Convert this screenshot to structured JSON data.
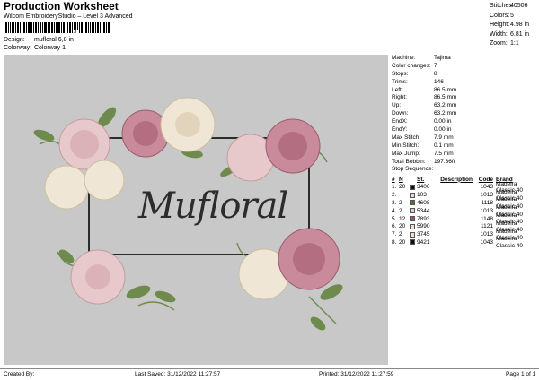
{
  "header": {
    "title": "Production Worksheet",
    "subtitle": "Wilcom EmbroideryStudio – Level 3 Advanced",
    "barcode_number": "3",
    "design_label": "Design:",
    "design_value": "mufloral 6,8 in",
    "colorway_label": "Colorway:",
    "colorway_value": "Colorway 1"
  },
  "top_stats": [
    {
      "label": "Stitches:",
      "value": "40506"
    },
    {
      "label": "Colors:",
      "value": "5"
    },
    {
      "label": "Height:",
      "value": "4.98 in"
    },
    {
      "label": "Width:",
      "value": "6.81 in"
    },
    {
      "label": "Zoom:",
      "value": "1:1"
    }
  ],
  "preview": {
    "text": "Mufloral",
    "background": "#c8c8c8"
  },
  "details": [
    {
      "label": "Machine:",
      "value": "Tajima"
    },
    {
      "label": "Color changes:",
      "value": "7"
    },
    {
      "label": "Stops:",
      "value": "8"
    },
    {
      "label": "Trims:",
      "value": "146"
    },
    {
      "label": "Left:",
      "value": "86.5 mm"
    },
    {
      "label": "Right:",
      "value": "86.5 mm"
    },
    {
      "label": "Up:",
      "value": "63.2 mm"
    },
    {
      "label": "Down:",
      "value": "63.2 mm"
    },
    {
      "label": "EndX:",
      "value": "0.00 in"
    },
    {
      "label": "EndY:",
      "value": "0.00 in"
    },
    {
      "label": "Max Stitch:",
      "value": "7.9 mm"
    },
    {
      "label": "Min Stitch:",
      "value": "0.1 mm"
    },
    {
      "label": "Max Jump:",
      "value": "7.5 mm"
    },
    {
      "label": "Total Bobbin:",
      "value": "197.36ft"
    }
  ],
  "sequence": {
    "title": "Stop Sequence:",
    "headers": {
      "n": "#",
      "n2": "N",
      "st": "St.",
      "desc": "Description",
      "code": "Code",
      "brand": "Brand"
    },
    "rows": [
      {
        "n": "1.",
        "needle": "20",
        "color": "#111111",
        "stitches": "3400",
        "code": "1043",
        "brand": "Madeira Classic 40"
      },
      {
        "n": "2.",
        "needle": "",
        "color": "#ead7d2",
        "stitches": "103",
        "code": "1013",
        "brand": "Madeira Classic 40"
      },
      {
        "n": "3.",
        "needle": "2",
        "color": "#5c6b3a",
        "stitches": "4608",
        "code": "1118",
        "brand": "Madeira Classic 40"
      },
      {
        "n": "4.",
        "needle": "2",
        "color": "#e3cfc4",
        "stitches": "5344",
        "code": "1013",
        "brand": "Madeira Classic 40"
      },
      {
        "n": "5.",
        "needle": "12",
        "color": "#b04a6a",
        "stitches": "7893",
        "code": "1148",
        "brand": "Madeira Classic 40"
      },
      {
        "n": "6.",
        "needle": "20",
        "color": "#f0d8e0",
        "stitches": "5990",
        "code": "1121",
        "brand": "Madeira Classic 40"
      },
      {
        "n": "7.",
        "needle": "2",
        "color": "#efe3d6",
        "stitches": "3745",
        "code": "1013",
        "brand": "Madeira Classic 40"
      },
      {
        "n": "8.",
        "needle": "20",
        "color": "#111111",
        "stitches": "9421",
        "code": "1043",
        "brand": "Madeira Classic 40"
      }
    ]
  },
  "footer": {
    "created_by": "Created By:",
    "last_saved": "Last Saved: 31/12/2022 11:27:57",
    "printed": "Printed: 31/12/2022 11:27:59",
    "page": "Page 1 of 1"
  }
}
